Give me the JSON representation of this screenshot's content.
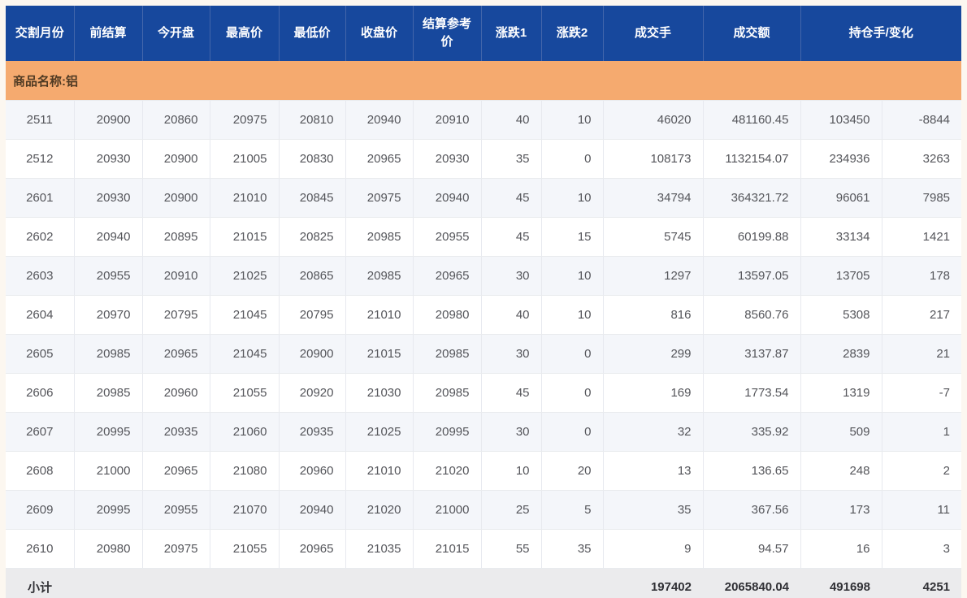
{
  "table": {
    "columns": [
      "交割月份",
      "前结算",
      "今开盘",
      "最高价",
      "最低价",
      "收盘价",
      "结算参考价",
      "涨跌1",
      "涨跌2",
      "成交手",
      "成交额",
      "持仓手/变化"
    ],
    "column_keys": [
      "delivery-month",
      "prev-settlement",
      "open",
      "high",
      "low",
      "close",
      "settlement-ref-price",
      "change-1",
      "change-2",
      "volume-lots",
      "turnover",
      "open-interest",
      "open-interest-change"
    ],
    "group_label": "商品名称:铝",
    "rows": [
      [
        "2511",
        "20900",
        "20860",
        "20975",
        "20810",
        "20940",
        "20910",
        "40",
        "10",
        "46020",
        "481160.45",
        "103450",
        "-8844"
      ],
      [
        "2512",
        "20930",
        "20900",
        "21005",
        "20830",
        "20965",
        "20930",
        "35",
        "0",
        "108173",
        "1132154.07",
        "234936",
        "3263"
      ],
      [
        "2601",
        "20930",
        "20900",
        "21010",
        "20845",
        "20975",
        "20940",
        "45",
        "10",
        "34794",
        "364321.72",
        "96061",
        "7985"
      ],
      [
        "2602",
        "20940",
        "20895",
        "21015",
        "20825",
        "20985",
        "20955",
        "45",
        "15",
        "5745",
        "60199.88",
        "33134",
        "1421"
      ],
      [
        "2603",
        "20955",
        "20910",
        "21025",
        "20865",
        "20985",
        "20965",
        "30",
        "10",
        "1297",
        "13597.05",
        "13705",
        "178"
      ],
      [
        "2604",
        "20970",
        "20795",
        "21045",
        "20795",
        "21010",
        "20980",
        "40",
        "10",
        "816",
        "8560.76",
        "5308",
        "217"
      ],
      [
        "2605",
        "20985",
        "20965",
        "21045",
        "20900",
        "21015",
        "20985",
        "30",
        "0",
        "299",
        "3137.87",
        "2839",
        "21"
      ],
      [
        "2606",
        "20985",
        "20960",
        "21055",
        "20920",
        "21030",
        "20985",
        "45",
        "0",
        "169",
        "1773.54",
        "1319",
        "-7"
      ],
      [
        "2607",
        "20995",
        "20935",
        "21060",
        "20935",
        "21025",
        "20995",
        "30",
        "0",
        "32",
        "335.92",
        "509",
        "1"
      ],
      [
        "2608",
        "21000",
        "20965",
        "21080",
        "20960",
        "21010",
        "21020",
        "10",
        "20",
        "13",
        "136.65",
        "248",
        "2"
      ],
      [
        "2609",
        "20995",
        "20955",
        "21070",
        "20940",
        "21020",
        "21000",
        "25",
        "5",
        "35",
        "367.56",
        "173",
        "11"
      ],
      [
        "2610",
        "20980",
        "20975",
        "21055",
        "20965",
        "21035",
        "21015",
        "55",
        "35",
        "9",
        "94.57",
        "16",
        "3"
      ]
    ],
    "subtotal": {
      "label": "小计",
      "volume": "197402",
      "turnover": "2065840.04",
      "open_interest": "491698",
      "open_interest_change": "4251"
    }
  },
  "colors": {
    "header_bg": "#17489d",
    "group_band_bg": "#f5aa6f",
    "stripe_bg": "#f4f6fa",
    "subtotal_bg": "#ebebed",
    "frame_bg": "#fcf7f0"
  }
}
